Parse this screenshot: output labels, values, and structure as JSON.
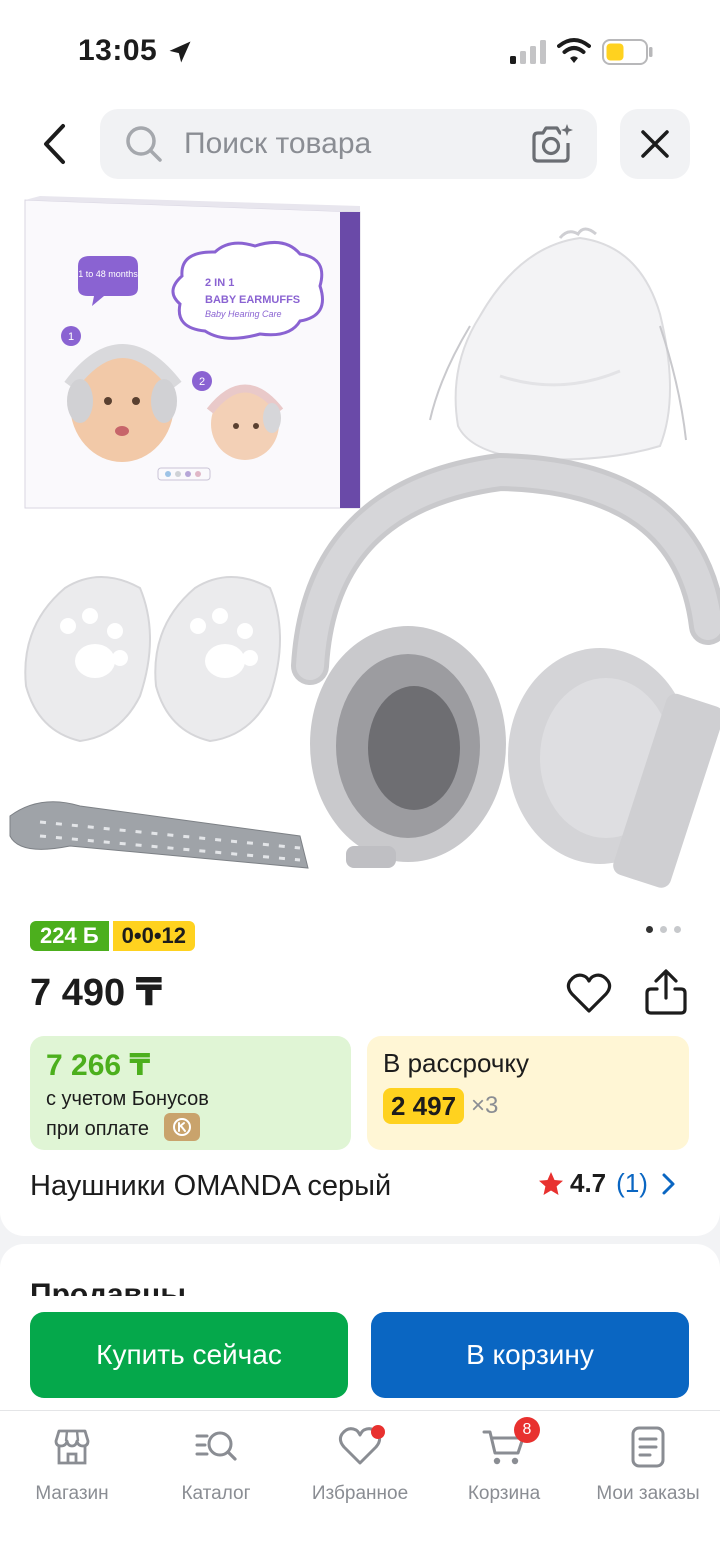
{
  "status_bar": {
    "time": "13:05"
  },
  "search": {
    "placeholder": "Поиск товара"
  },
  "product": {
    "image_pagination": {
      "total": 3,
      "active": 1
    },
    "bonus_badge": "224 Б",
    "installment_badge": "0•0•12",
    "price": "7 490 ₸",
    "bonus_price": "7 266 ₸",
    "bonus_line1": "с учетом Бонусов",
    "bonus_line2": "при оплате",
    "installment_title": "В рассрочку",
    "installment_amount": "2 497",
    "installment_multiplier": "×3",
    "title": "Наушники OMANDA серый",
    "rating": "4.7",
    "review_count": "(1)",
    "box_text": {
      "age": "1 to 48 months",
      "headline1": "2 IN 1",
      "headline2": "BABY EARMUFFS",
      "tagline": "Baby Hearing Care",
      "step1": "1",
      "step2": "2"
    }
  },
  "sellers": {
    "title": "Продавцы"
  },
  "actions": {
    "buy_now": "Купить сейчас",
    "add_to_cart": "В корзину"
  },
  "tabbar": {
    "items": [
      {
        "label": "Магазин",
        "icon": "shop-icon"
      },
      {
        "label": "Каталог",
        "icon": "catalog-icon"
      },
      {
        "label": "Избранное",
        "icon": "heart-icon"
      },
      {
        "label": "Корзина",
        "icon": "cart-icon",
        "badge": "8"
      },
      {
        "label": "Мои заказы",
        "icon": "orders-icon"
      }
    ]
  },
  "colors": {
    "bonus_green": "#4caf1d",
    "installment_yellow": "#ffd21f",
    "buy_green": "#05a84b",
    "cart_blue": "#0a66c2",
    "badge_red": "#e8312f"
  }
}
